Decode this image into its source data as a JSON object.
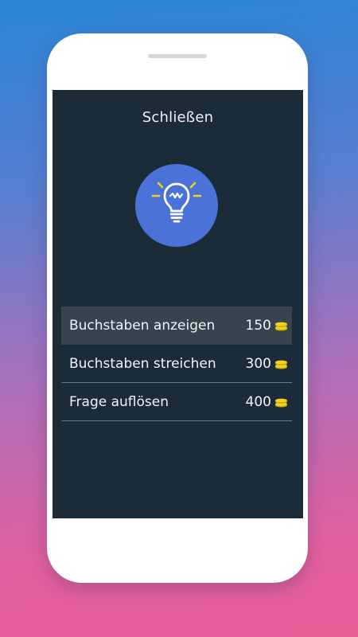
{
  "dialog": {
    "close_label": "Schließen",
    "icon": "lightbulb-icon",
    "accent_color": "#4a72d9",
    "background_color": "#1c2b38"
  },
  "hints": [
    {
      "label": "Buchstaben anzeigen",
      "cost": "150",
      "icon": "coins-icon",
      "selected": true
    },
    {
      "label": "Buchstaben streichen",
      "cost": "300",
      "icon": "coins-icon",
      "selected": false
    },
    {
      "label": "Frage auflösen",
      "cost": "400",
      "icon": "coins-icon",
      "selected": false
    }
  ],
  "coin_color": "#f2d21b"
}
